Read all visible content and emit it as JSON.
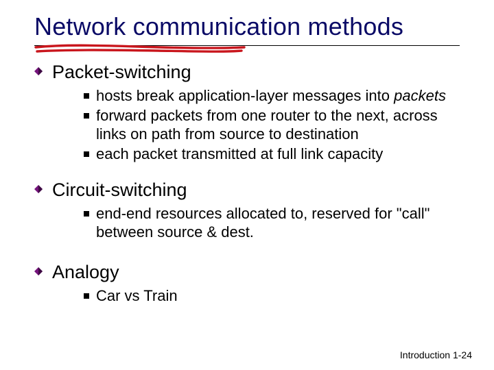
{
  "title": "Network communication methods",
  "sections": [
    {
      "heading": "Packet-switching",
      "subs": [
        "hosts break application-layer messages into <em>packets</em>",
        "forward packets from one router to the next, across links on path from source to destination",
        "each packet transmitted at full link capacity"
      ]
    },
    {
      "heading": "Circuit-switching",
      "subs": [
        "end-end resources allocated to, reserved for \"call\" between source & dest."
      ]
    },
    {
      "heading": "Analogy",
      "subs": [
        "Car vs Train"
      ]
    }
  ],
  "footer": "Introduction 1-24",
  "colors": {
    "title": "#0a0a66",
    "accent": "#c9161d",
    "diamond": "#75147c"
  }
}
